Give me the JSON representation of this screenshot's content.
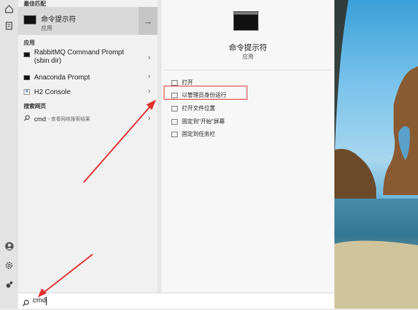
{
  "sections": {
    "best_match": "最佳匹配",
    "apps": "应用",
    "web": "搜索网页"
  },
  "best_match": {
    "title": "命令提示符",
    "subtitle": "应用",
    "icon": "cmd-window-icon"
  },
  "apps": [
    {
      "label": "RabbitMQ Command Prompt",
      "label2": "(sbin dir)",
      "icon": "console-icon"
    },
    {
      "label": "Anaconda Prompt",
      "icon": "console-icon"
    },
    {
      "label": "H2 Console",
      "icon": "h2-icon"
    }
  ],
  "web_result": {
    "query": "cmd",
    "hint": "- 查看网络搜索结果"
  },
  "preview": {
    "title": "命令提示符",
    "subtitle": "应用",
    "actions": [
      {
        "label": "打开",
        "icon": "open-icon"
      },
      {
        "label": "以管理员身份运行",
        "icon": "admin-shield-icon",
        "highlighted": true
      },
      {
        "label": "打开文件位置",
        "icon": "folder-icon"
      },
      {
        "label": "固定到\"开始\"屏幕",
        "icon": "pin-icon"
      },
      {
        "label": "固定到任务栏",
        "icon": "pin-icon"
      }
    ]
  },
  "search": {
    "value": "cmd"
  },
  "colors": {
    "highlight_box": "#e0312f",
    "arrow": "#e0312f"
  }
}
